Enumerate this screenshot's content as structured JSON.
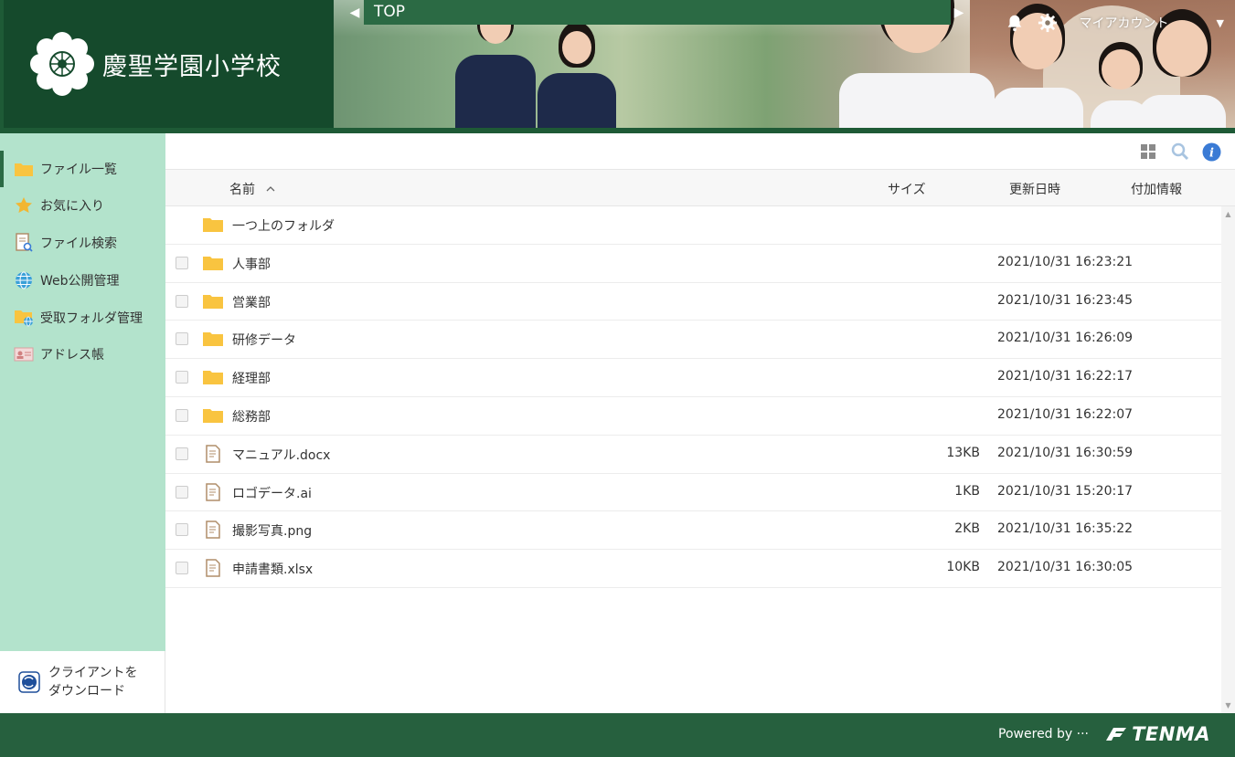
{
  "header": {
    "school_name": "慶聖学園小学校",
    "nav_title": "TOP",
    "account_label": "マイアカウント"
  },
  "sidebar": {
    "items": [
      {
        "label": "ファイル一覧",
        "icon": "folder-icon"
      },
      {
        "label": "お気に入り",
        "icon": "star-icon"
      },
      {
        "label": "ファイル検索",
        "icon": "file-search-icon"
      },
      {
        "label": "Web公開管理",
        "icon": "globe-icon"
      },
      {
        "label": "受取フォルダ管理",
        "icon": "receive-folder-icon"
      },
      {
        "label": "アドレス帳",
        "icon": "address-book-icon"
      }
    ],
    "download": {
      "line1": "クライアントを",
      "line2": "ダウンロード"
    }
  },
  "table": {
    "columns": {
      "name": "名前",
      "size": "サイズ",
      "date": "更新日時",
      "info": "付加情報"
    },
    "parent_folder": "一つ上のフォルダ",
    "rows": [
      {
        "type": "folder",
        "name": "人事部",
        "size": "",
        "date": "2021/10/31 16:23:21"
      },
      {
        "type": "folder",
        "name": "営業部",
        "size": "",
        "date": "2021/10/31 16:23:45"
      },
      {
        "type": "folder",
        "name": "研修データ",
        "size": "",
        "date": "2021/10/31 16:26:09"
      },
      {
        "type": "folder",
        "name": "経理部",
        "size": "",
        "date": "2021/10/31 16:22:17"
      },
      {
        "type": "folder",
        "name": "総務部",
        "size": "",
        "date": "2021/10/31 16:22:07"
      },
      {
        "type": "file",
        "name": "マニュアル.docx",
        "size": "13KB",
        "date": "2021/10/31 16:30:59"
      },
      {
        "type": "file",
        "name": "ロゴデータ.ai",
        "size": "1KB",
        "date": "2021/10/31 15:20:17"
      },
      {
        "type": "file",
        "name": "撮影写真.png",
        "size": "2KB",
        "date": "2021/10/31 16:35:22"
      },
      {
        "type": "file",
        "name": "申請書類.xlsx",
        "size": "10KB",
        "date": "2021/10/31 16:30:05"
      }
    ]
  },
  "footer": {
    "powered": "Powered by ···",
    "brand": "TENMA"
  },
  "colors": {
    "header_dark": "#154a2c",
    "header": "#1e5a36",
    "sidebar": "#b3e3cc",
    "footer": "#26603e",
    "folder": "#f9c440",
    "info": "#3a7bd5"
  }
}
